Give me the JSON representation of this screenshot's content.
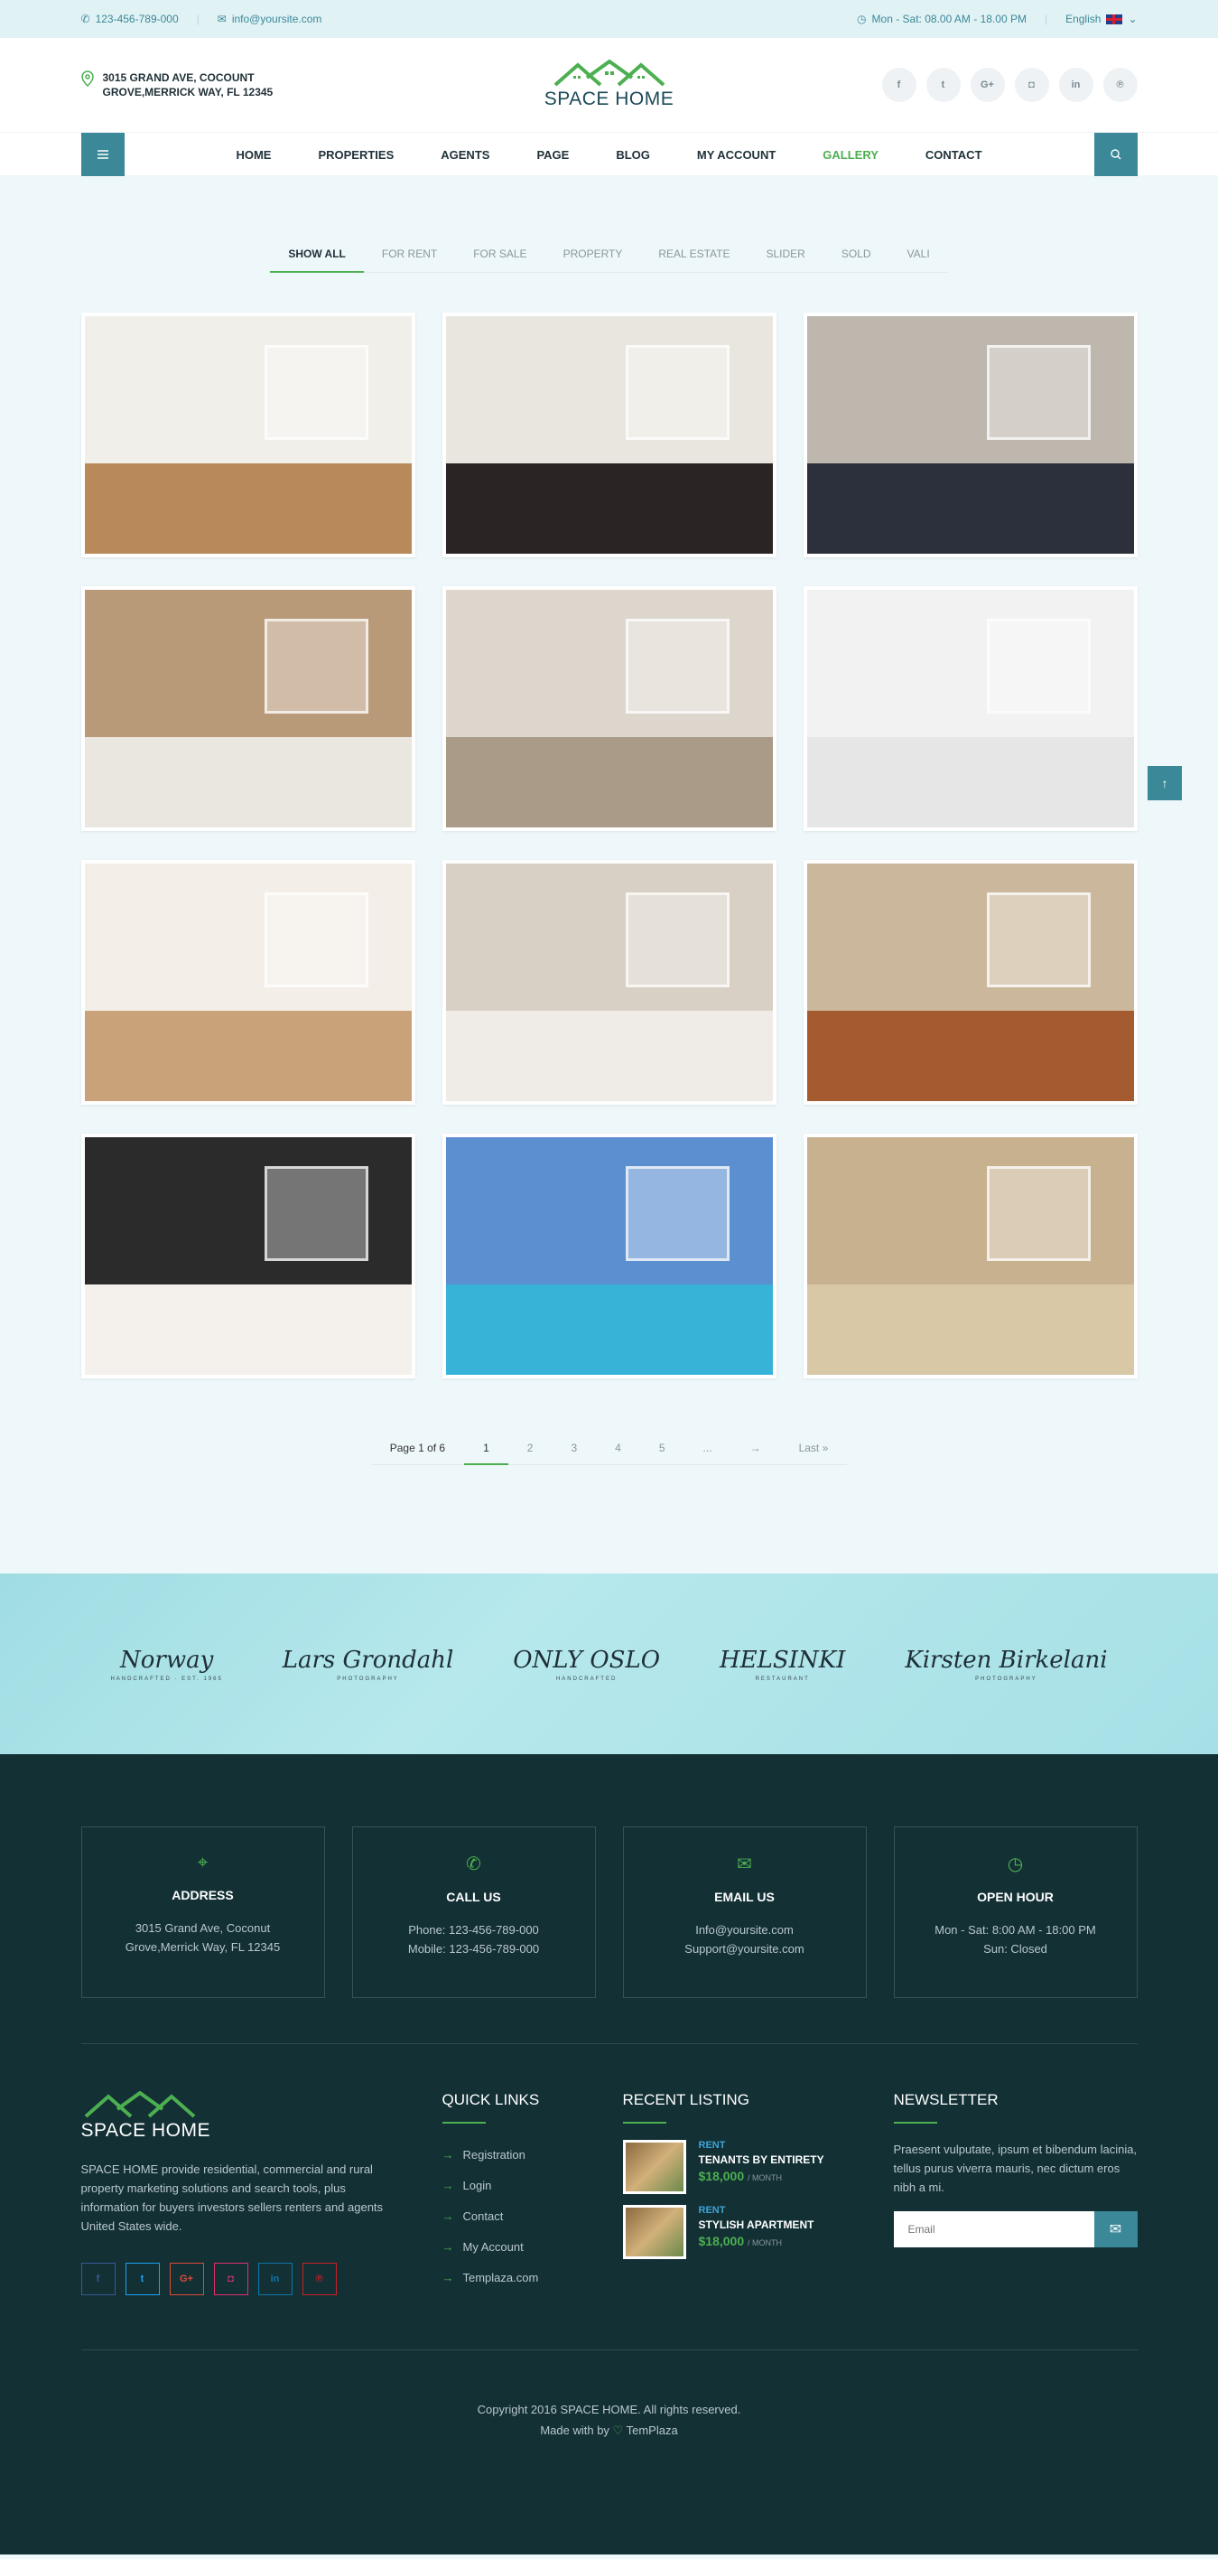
{
  "topbar": {
    "phone": "123-456-789-000",
    "email": "info@yoursite.com",
    "hours": "Mon - Sat: 08.00 AM - 18.00 PM",
    "language": "English"
  },
  "header": {
    "address_line1": "3015 GRAND AVE, COCOUNT",
    "address_line2": "GROVE,MERRICK WAY, FL 12345",
    "logo_text": "SPACE HOME",
    "socials": [
      {
        "icon": "facebook-icon",
        "glyph": "f"
      },
      {
        "icon": "twitter-icon",
        "glyph": "t"
      },
      {
        "icon": "google-plus-icon",
        "glyph": "G+"
      },
      {
        "icon": "instagram-icon",
        "glyph": "◘"
      },
      {
        "icon": "linkedin-icon",
        "glyph": "in"
      },
      {
        "icon": "pinterest-icon",
        "glyph": "℗"
      }
    ]
  },
  "nav": {
    "items": [
      "HOME",
      "PROPERTIES",
      "AGENTS",
      "PAGE",
      "BLOG",
      "MY ACCOUNT",
      "GALLERY",
      "CONTACT"
    ],
    "active": "GALLERY"
  },
  "filters": {
    "items": [
      "SHOW ALL",
      "FOR RENT",
      "FOR SALE",
      "PROPERTY",
      "REAL ESTATE",
      "SLIDER",
      "SOLD",
      "VALI"
    ],
    "active": "SHOW ALL"
  },
  "gallery": [
    {
      "name": "study-room-photo",
      "wall": "#f1efea",
      "floor": "#b88a5a"
    },
    {
      "name": "bedroom-photo",
      "wall": "#e9e6df",
      "floor": "#2a2524"
    },
    {
      "name": "living-room-gray-photo",
      "wall": "#bdb7ad",
      "floor": "#2c2f3c"
    },
    {
      "name": "bedroom-wardrobe-photo",
      "wall": "#b89a78",
      "floor": "#eae6e0"
    },
    {
      "name": "living-room-window-photo",
      "wall": "#ddd6cc",
      "floor": "#a99b88"
    },
    {
      "name": "bathroom-photo",
      "wall": "#f2f2f2",
      "floor": "#e6e6e6"
    },
    {
      "name": "kitchen-photo",
      "wall": "#f3efe8",
      "floor": "#caa27a"
    },
    {
      "name": "white-lounge-photo",
      "wall": "#d8d0c4",
      "floor": "#efece7"
    },
    {
      "name": "dining-room-photo",
      "wall": "#cbb89c",
      "floor": "#a55b30"
    },
    {
      "name": "zebra-bedroom-photo",
      "wall": "#2b2b2b",
      "floor": "#f4f1ec"
    },
    {
      "name": "pool-photo",
      "wall": "#5b8fd0",
      "floor": "#37b3d8"
    },
    {
      "name": "classic-bedroom-photo",
      "wall": "#c7b18f",
      "floor": "#d8c8a6"
    }
  ],
  "pagination": {
    "info": "Page 1 of 6",
    "pages": [
      "1",
      "2",
      "3",
      "4",
      "5",
      "...",
      "→",
      "Last »"
    ],
    "active": "1"
  },
  "brands": [
    {
      "name": "Norway",
      "sub": "HANDCRAFTED · EST. 1965"
    },
    {
      "name": "Lars Grondahl",
      "sub": "PHOTOGRAPHY"
    },
    {
      "name": "ONLY OSLO",
      "sub": "HANDCRAFTED"
    },
    {
      "name": "HELSINKI",
      "sub": "RESTAURANT"
    },
    {
      "name": "Kirsten Birkelani",
      "sub": "PHOTOGRAPHY"
    }
  ],
  "contact": [
    {
      "icon": "map-pin-icon",
      "glyph": "⌖",
      "title": "ADDRESS",
      "lines": [
        "3015 Grand Ave, Coconut",
        "Grove,Merrick Way, FL 12345"
      ]
    },
    {
      "icon": "phone-icon",
      "glyph": "✆",
      "title": "CALL US",
      "lines": [
        "Phone: 123-456-789-000",
        "Mobile: 123-456-789-000"
      ]
    },
    {
      "icon": "envelope-icon",
      "glyph": "✉",
      "title": "EMAIL US",
      "lines": [
        "Info@yoursite.com",
        "Support@yoursite.com"
      ]
    },
    {
      "icon": "clock-icon",
      "glyph": "◷",
      "title": "OPEN HOUR",
      "lines": [
        "Mon - Sat: 8:00 AM - 18:00 PM",
        "Sun: Closed"
      ]
    }
  ],
  "footer": {
    "logo_text": "SPACE HOME",
    "about": "SPACE HOME provide residential, commercial and rural property marketing solutions and search tools, plus information for buyers investors sellers renters and agents United States wide.",
    "social": [
      {
        "icon": "facebook-icon",
        "glyph": "f",
        "color": "#3b5998"
      },
      {
        "icon": "twitter-icon",
        "glyph": "t",
        "color": "#1da1f2"
      },
      {
        "icon": "google-plus-icon",
        "glyph": "G+",
        "color": "#dd4b39"
      },
      {
        "icon": "instagram-icon",
        "glyph": "◘",
        "color": "#e1306c"
      },
      {
        "icon": "linkedin-icon",
        "glyph": "in",
        "color": "#0e76a8"
      },
      {
        "icon": "pinterest-icon",
        "glyph": "℗",
        "color": "#cb2027"
      }
    ],
    "quick_links_title": "QUICK LINKS",
    "quick_links": [
      "Registration",
      "Login",
      "Contact",
      "My Account",
      "Templaza.com"
    ],
    "recent_title": "RECENT LISTING",
    "recent": [
      {
        "tag": "RENT",
        "name": "TENANTS BY ENTIRETY",
        "price": "$18,000",
        "per": "/ MONTH"
      },
      {
        "tag": "RENT",
        "name": "STYLISH APARTMENT",
        "price": "$18,000",
        "per": "/ MONTH"
      }
    ],
    "newsletter_title": "NEWSLETTER",
    "newsletter_text": "Praesent vulputate, ipsum et bibendum lacinia, tellus purus viverra mauris, nec dictum eros nibh a mi.",
    "newsletter_placeholder": "Email",
    "copyright": "Copyright 2016 SPACE HOME. All rights reserved.",
    "made_with_prefix": "Made with by",
    "made_with_brand": "TemPlaza"
  },
  "colors": {
    "accent_green": "#4caf50",
    "accent_teal": "#3a8898",
    "footer_bg": "#133035"
  }
}
